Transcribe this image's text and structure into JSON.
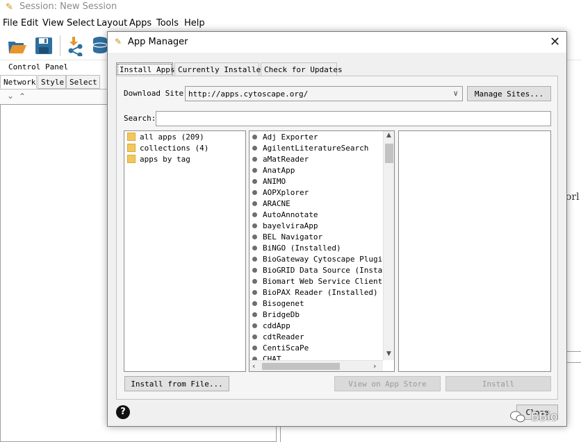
{
  "main_window": {
    "title": "Session: New Session",
    "menu": [
      "File",
      "Edit",
      "View",
      "Select",
      "Layout",
      "Apps",
      "Tools",
      "Help"
    ],
    "control_panel_label": "Control Panel",
    "control_panel_tabs": [
      "Network",
      "Style",
      "Select"
    ],
    "partial_background_text": "orl"
  },
  "dialog": {
    "title": "App Manager",
    "tabs": [
      "Install Apps",
      "Currently Installed",
      "Check for Updates"
    ],
    "active_tab": "Install Apps",
    "download_site_label": "Download Site:",
    "download_site_value": "http://apps.cytoscape.org/",
    "manage_sites_label": "Manage Sites...",
    "search_label": "Search:",
    "search_value": "",
    "tags": [
      "all apps (209)",
      "collections (4)",
      "apps by tag"
    ],
    "apps": [
      "Adj Exporter",
      "AgilentLiteratureSearch",
      "aMatReader",
      "AnatApp",
      "ANIMO",
      "AOPXplorer",
      "ARACNE",
      "AutoAnnotate",
      "bayelviraApp",
      "BEL Navigator",
      "BiNGO (Installed)",
      "BioGateway Cytoscape Plugin",
      "BioGRID Data Source (Installe",
      "Biomart Web Service Client",
      "BioPAX Reader (Installed)",
      "Bisogenet",
      "BridgeDb",
      "cddApp",
      "cdtReader",
      "CentiScaPe",
      "CHAT"
    ],
    "install_from_file_label": "Install from File...",
    "view_on_store_label": "View on App Store",
    "install_label": "Install",
    "help_label": "?",
    "close_label": "Close"
  },
  "watermark": {
    "text": "BBio"
  },
  "colors": {
    "folder": "#f3c85a",
    "toolbar_orange": "#e8952b",
    "toolbar_blue": "#2f6f9f",
    "disabled_text": "#9a9a9a"
  }
}
